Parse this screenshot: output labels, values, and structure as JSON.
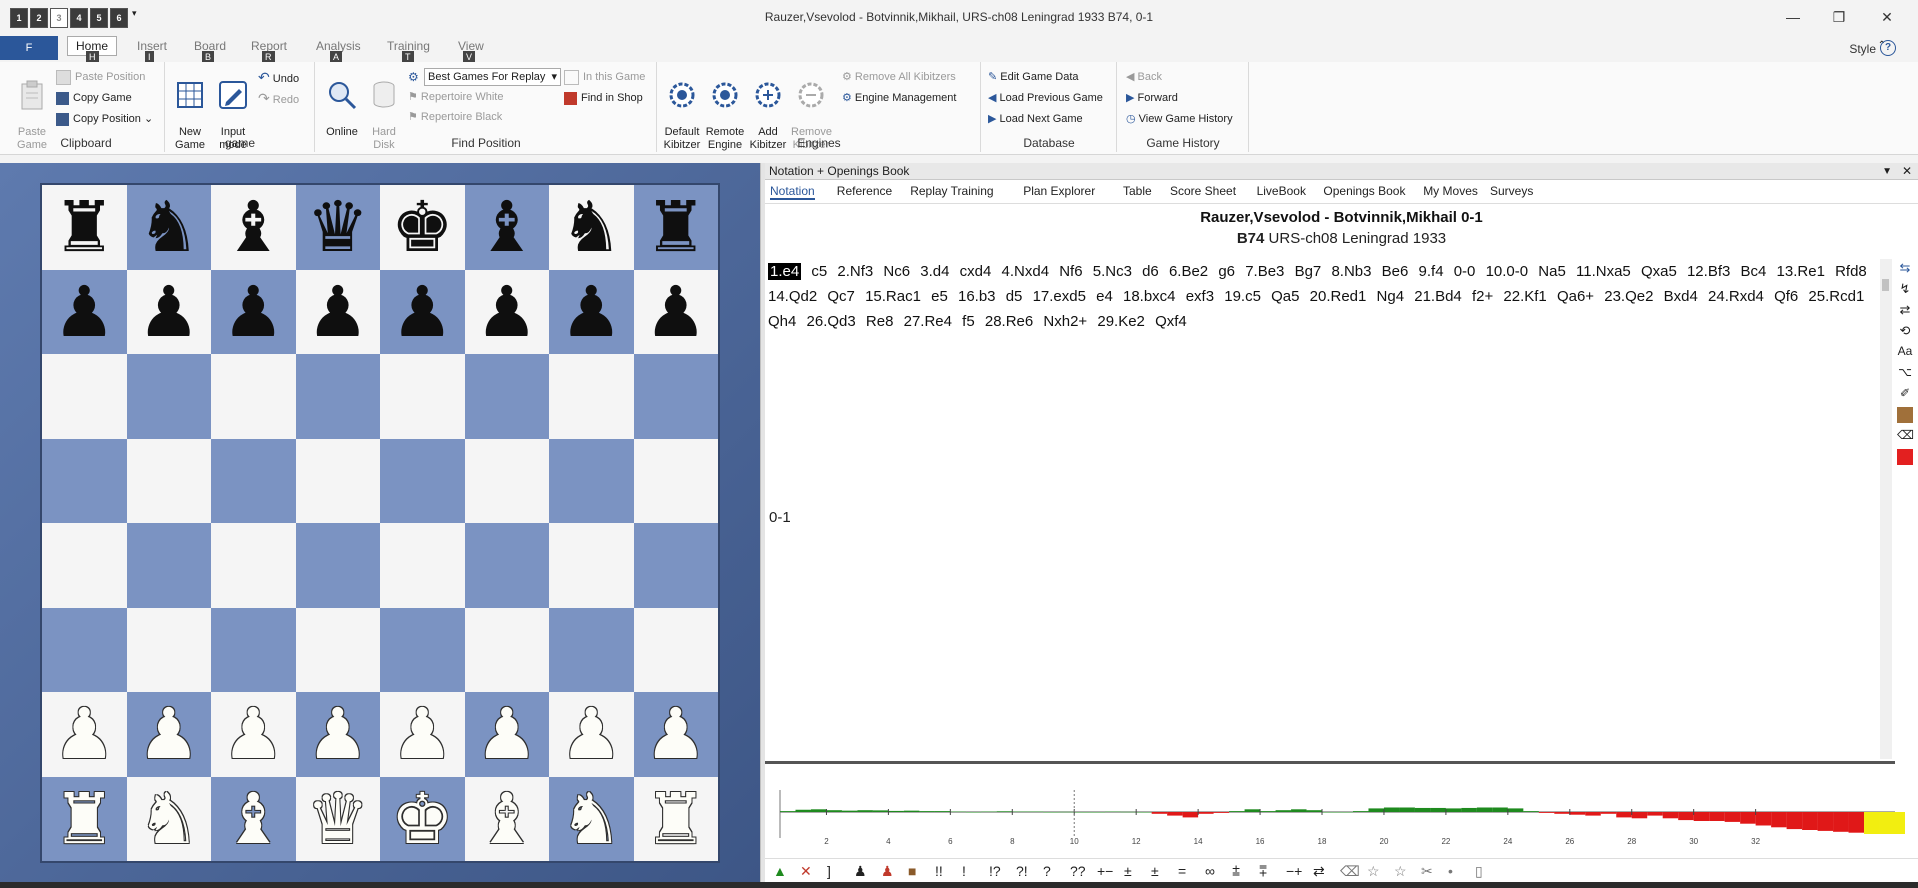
{
  "window": {
    "title": "Rauzer,Vsevolod - Botvinnik,Mikhail, URS-ch08 Leningrad 1933  B74, 0-1",
    "quick_access": [
      "1",
      "2",
      "3",
      "4",
      "5",
      "6"
    ]
  },
  "ribbon_tabs": {
    "file": "F",
    "tabs": [
      {
        "label": "Home",
        "key": "H"
      },
      {
        "label": "Insert",
        "key": "I"
      },
      {
        "label": "Board",
        "key": "B"
      },
      {
        "label": "Report",
        "key": "R"
      },
      {
        "label": "Analysis",
        "key": "A"
      },
      {
        "label": "Training",
        "key": "T"
      },
      {
        "label": "View",
        "key": "V"
      }
    ],
    "style": "Style"
  },
  "clipboard": {
    "paste_game": "Paste\nGame",
    "paste_position": "Paste Position",
    "copy_game": "Copy Game",
    "copy_position": "Copy Position",
    "label": "Clipboard"
  },
  "game_group": {
    "new_game": "New\nGame",
    "input_mode": "Input\nmode",
    "undo": "Undo",
    "redo": "Redo",
    "label": "game"
  },
  "find_position": {
    "online": "Online",
    "hard_disk": "Hard\nDisk",
    "combo_value": "Best Games For Replay",
    "repertoire_white": "Repertoire White",
    "repertoire_black": "Repertoire Black",
    "in_this_game": "In this Game",
    "find_in_shop": "Find in Shop",
    "label": "Find Position"
  },
  "engines": {
    "default_kibitzer": "Default\nKibitzer",
    "remote_engine": "Remote\nEngine",
    "add_kibitzer": "Add\nKibitzer",
    "remove_kibitzer": "Remove\nKibitzer",
    "remove_all": "Remove All Kibitzers",
    "engine_management": "Engine Management",
    "label": "Engines"
  },
  "database": {
    "edit_game_data": "Edit Game Data",
    "load_previous": "Load Previous Game",
    "load_next": "Load Next Game",
    "label": "Database"
  },
  "history": {
    "back": "Back",
    "forward": "Forward",
    "view_history": "View Game History",
    "label": "Game History"
  },
  "board": {
    "rows": [
      [
        "r",
        "n",
        "b",
        "q",
        "k",
        "b",
        "n",
        "r"
      ],
      [
        "p",
        "p",
        "p",
        "p",
        "p",
        "p",
        "p",
        "p"
      ],
      [
        "",
        "",
        "",
        "",
        "",
        "",
        "",
        ""
      ],
      [
        "",
        "",
        "",
        "",
        "",
        "",
        "",
        ""
      ],
      [
        "",
        "",
        "",
        "",
        "",
        "",
        "",
        ""
      ],
      [
        "",
        "",
        "",
        "",
        "",
        "",
        "",
        ""
      ],
      [
        "P",
        "P",
        "P",
        "P",
        "P",
        "P",
        "P",
        "P"
      ],
      [
        "R",
        "N",
        "B",
        "Q",
        "K",
        "B",
        "N",
        "R"
      ]
    ]
  },
  "notation_panel": {
    "title": "Notation + Openings Book",
    "tabs": [
      "Notation",
      "Reference",
      "Replay Training",
      "Plan Explorer",
      "Table",
      "Score Sheet",
      "LiveBook",
      "Openings Book",
      "My Moves",
      "Surveys"
    ],
    "players": "Rauzer,Vsevolod - Botvinnik,Mikhail  0-1",
    "eco": "B74",
    "event": "URS-ch08 Leningrad 1933",
    "moves": [
      "1.e4",
      "c5",
      "2.Nf3",
      "Nc6",
      "3.d4",
      "cxd4",
      "4.Nxd4",
      "Nf6",
      "5.Nc3",
      "d6",
      "6.Be2",
      "g6",
      "7.Be3",
      "Bg7",
      "8.Nb3",
      "Be6",
      "9.f4",
      "0-0",
      "10.0-0",
      "Na5",
      "11.Nxa5",
      "Qxa5",
      "12.Bf3",
      "Bc4",
      "13.Re1",
      "Rfd8",
      "14.Qd2",
      "Qc7",
      "15.Rac1",
      "e5",
      "16.b3",
      "d5",
      "17.exd5",
      "e4",
      "18.bxc4",
      "exf3",
      "19.c5",
      "Qa5",
      "20.Red1",
      "Ng4",
      "21.Bd4",
      "f2+",
      "22.Kf1",
      "Qa6+",
      "23.Qe2",
      "Bxd4",
      "24.Rxd4",
      "Qf6",
      "25.Rcd1",
      "Qh4",
      "26.Qd3",
      "Re8",
      "27.Re4",
      "f5",
      "28.Re6",
      "Nxh2+",
      "29.Ke2",
      "Qxf4"
    ],
    "current_move_index": 0,
    "result": "0-1"
  },
  "eval_graph": {
    "x_ticks": [
      "2",
      "4",
      "6",
      "8",
      "10",
      "12",
      "14",
      "16",
      "18",
      "20",
      "22",
      "24",
      "26",
      "28",
      "30",
      "32"
    ],
    "values": [
      0.1,
      0.25,
      0.3,
      0.2,
      0.15,
      0.2,
      0.18,
      0.12,
      0.15,
      0.1,
      0.1,
      0.05,
      0.0,
      0.05,
      0.08,
      0.05,
      0.05,
      0.0,
      0.02,
      0.0,
      0.0,
      0.05,
      0.02,
      0.0,
      -0.2,
      -0.4,
      -0.6,
      -0.2,
      -0.1,
      0.1,
      0.3,
      0.1,
      0.2,
      0.3,
      0.2,
      0.0,
      0.0,
      0.1,
      0.4,
      0.5,
      0.5,
      0.45,
      0.45,
      0.4,
      0.45,
      0.5,
      0.5,
      0.4,
      0.1,
      -0.1,
      -0.2,
      -0.3,
      -0.4,
      -0.2,
      -0.6,
      -0.7,
      -0.4,
      -0.7,
      -0.9,
      -1.0,
      -1.0,
      -1.1,
      -1.3,
      -1.5,
      -1.7,
      -1.9,
      -2.0,
      -2.1,
      -2.2,
      -2.3,
      -2.5,
      -2.5,
      -2.5,
      -2.5,
      -2.5,
      -2.5,
      -2.5,
      -2.5
    ],
    "colors": {
      "white_adv": "#1e8a1e",
      "black_adv": "#e01818",
      "decisive": "#f2ee10"
    }
  },
  "glyphs": [
    "!!",
    "!",
    "!?",
    "?!",
    "?",
    "??",
    "+−",
    "±",
    "±",
    "=",
    "∞",
    "⩲",
    "⩱",
    "−+",
    "⇄"
  ]
}
